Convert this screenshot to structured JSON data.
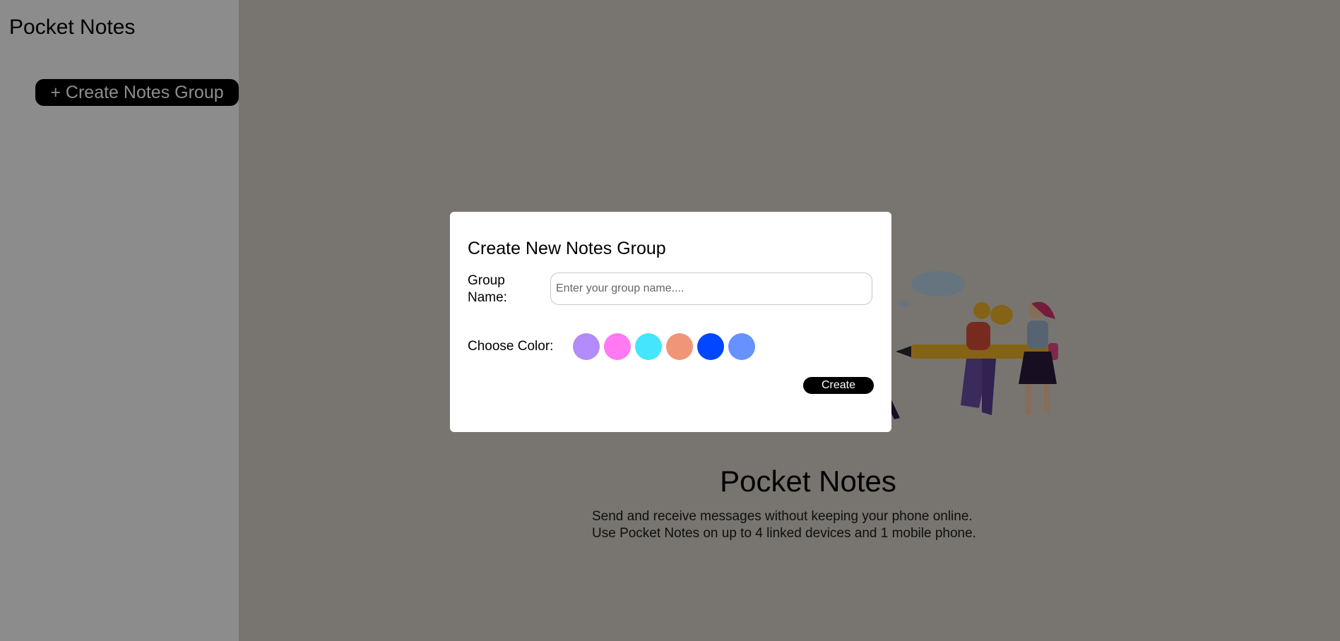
{
  "sidebar": {
    "title": "Pocket Notes",
    "create_button_label": "+ Create Notes Group"
  },
  "main": {
    "title": "Pocket Notes",
    "description_lines": [
      "Send and receive messages without keeping your phone online.",
      "Use Pocket Notes on up to 4 linked devices and 1 mobile phone."
    ]
  },
  "modal": {
    "title": "Create New Notes Group",
    "group_name_label": "Group Name:",
    "group_name_placeholder": "Enter your group name....",
    "group_name_value": "",
    "color_label": "Choose Color:",
    "colors": [
      "#b38bfa",
      "#ff79f2",
      "#43e6fc",
      "#f19576",
      "#0047ff",
      "#6691ff"
    ],
    "create_button_label": "Create"
  }
}
